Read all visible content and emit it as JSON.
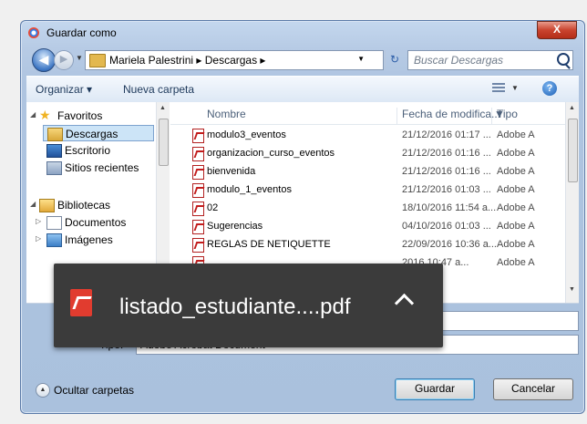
{
  "window": {
    "title": "Guardar como",
    "close_label": "X"
  },
  "nav": {
    "back_icon": "back-arrow-icon",
    "address": "Mariela Palestrini  ▸  Descargas  ▸",
    "search_placeholder": "Buscar Descargas"
  },
  "toolbar": {
    "organize": "Organizar ▾",
    "new_folder": "Nueva carpeta"
  },
  "sidebar": {
    "items": [
      {
        "label": "Favoritos",
        "icon": "star-icon",
        "tri": "◢",
        "indent": 0
      },
      {
        "label": "Descargas",
        "icon": "downloads-folder-icon",
        "tri": "",
        "indent": 1,
        "selected": true
      },
      {
        "label": "Escritorio",
        "icon": "desktop-icon",
        "tri": "",
        "indent": 1
      },
      {
        "label": "Sitios recientes",
        "icon": "recent-places-icon",
        "tri": "",
        "indent": 1
      },
      {
        "label": "Bibliotecas",
        "icon": "libraries-icon",
        "tri": "◢",
        "indent": 0
      },
      {
        "label": "Documentos",
        "icon": "documents-icon",
        "tri": "▷",
        "indent": 1
      },
      {
        "label": "Imágenes",
        "icon": "images-icon",
        "tri": "▷",
        "indent": 1
      }
    ]
  },
  "files": {
    "columns": {
      "name": "Nombre",
      "date": "Fecha de modifica...",
      "type": "Tipo"
    },
    "rows": [
      {
        "name": "modulo3_eventos",
        "date": "21/12/2016 01:17 ...",
        "type": "Adobe A"
      },
      {
        "name": "organizacion_curso_eventos",
        "date": "21/12/2016 01:16 ...",
        "type": "Adobe A"
      },
      {
        "name": "bienvenida",
        "date": "21/12/2016 01:16 ...",
        "type": "Adobe A"
      },
      {
        "name": "modulo_1_eventos",
        "date": "21/12/2016 01:03 ...",
        "type": "Adobe A"
      },
      {
        "name": "02",
        "date": "18/10/2016 11:54 a...",
        "type": "Adobe A"
      },
      {
        "name": "Sugerencias",
        "date": "04/10/2016 01:03 ...",
        "type": "Adobe A"
      },
      {
        "name": "REGLAS DE NETIQUETTE",
        "date": "22/09/2016 10:36 a...",
        "type": "Adobe A"
      },
      {
        "name": "",
        "date": "2016 10:47 a...",
        "type": "Adobe A"
      }
    ]
  },
  "fields": {
    "filename_value": "",
    "type_label": "Tipo:",
    "type_value": "Adobe Acrobat Document"
  },
  "footer": {
    "hide_folders": "Ocultar carpetas",
    "save": "Guardar",
    "cancel": "Cancelar"
  },
  "download_toast": {
    "filename": "listado_estudiante....pdf",
    "icon": "pdf-file-icon"
  }
}
